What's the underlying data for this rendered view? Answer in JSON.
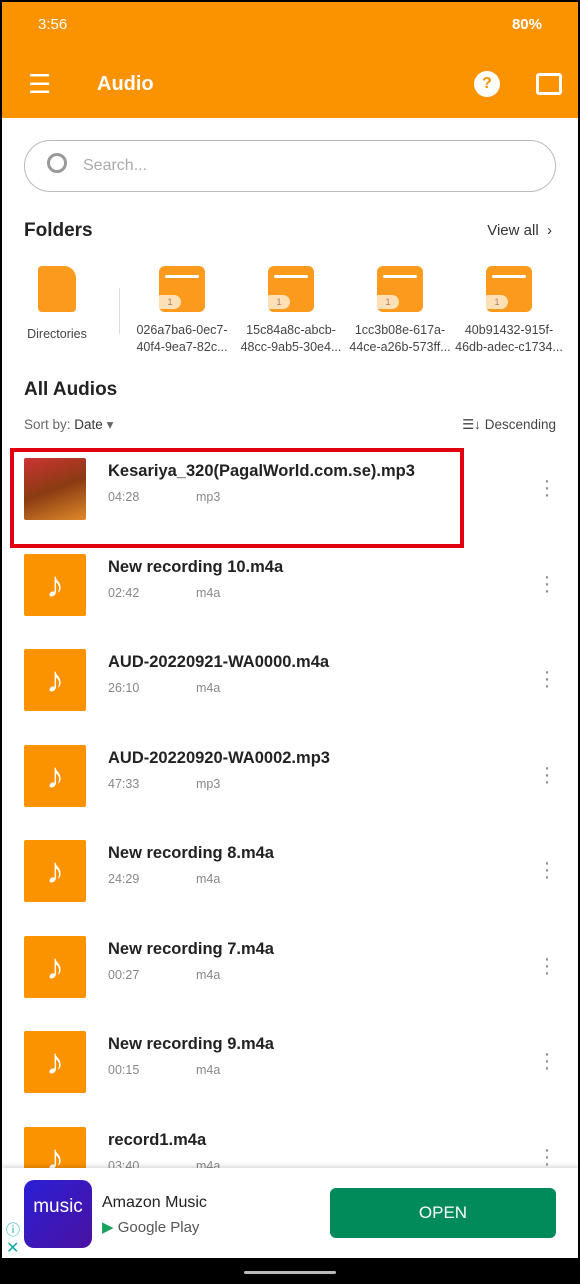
{
  "status": {
    "time": "3:56",
    "battery": "80%"
  },
  "appbar": {
    "title": "Audio"
  },
  "search": {
    "placeholder": "Search..."
  },
  "folders": {
    "title": "Folders",
    "view_all": "View all",
    "items": [
      {
        "label": "Directories"
      },
      {
        "label": "026a7ba6-0ec7-40f4-9ea7-82c..."
      },
      {
        "label": "15c84a8c-abcb-48cc-9ab5-30e4..."
      },
      {
        "label": "1cc3b08e-617a-44ce-a26b-573ff..."
      },
      {
        "label": "40b91432-915f-46db-adec-c1734..."
      }
    ]
  },
  "audios": {
    "title": "All Audios",
    "sort_label": "Sort by:",
    "sort_value": "Date",
    "order": "Descending",
    "items": [
      {
        "name": "Kesariya_320(PagalWorld.com.se).mp3",
        "duration": "04:28",
        "type": "mp3",
        "highlighted": true
      },
      {
        "name": "New recording 10.m4a",
        "duration": "02:42",
        "type": "m4a"
      },
      {
        "name": "AUD-20220921-WA0000.m4a",
        "duration": "26:10",
        "type": "m4a"
      },
      {
        "name": "AUD-20220920-WA0002.mp3",
        "duration": "47:33",
        "type": "mp3"
      },
      {
        "name": "New recording 8.m4a",
        "duration": "24:29",
        "type": "m4a"
      },
      {
        "name": "New recording 7.m4a",
        "duration": "00:27",
        "type": "m4a"
      },
      {
        "name": "New recording 9.m4a",
        "duration": "00:15",
        "type": "m4a"
      },
      {
        "name": "record1.m4a",
        "duration": "03:40",
        "type": "m4a"
      }
    ]
  },
  "ad": {
    "logo_text": "music",
    "app": "Amazon Music",
    "store": "Google Play",
    "cta": "OPEN"
  },
  "colors": {
    "accent": "#fb9200",
    "highlight": "#e0000f",
    "cta": "#018a5a"
  }
}
